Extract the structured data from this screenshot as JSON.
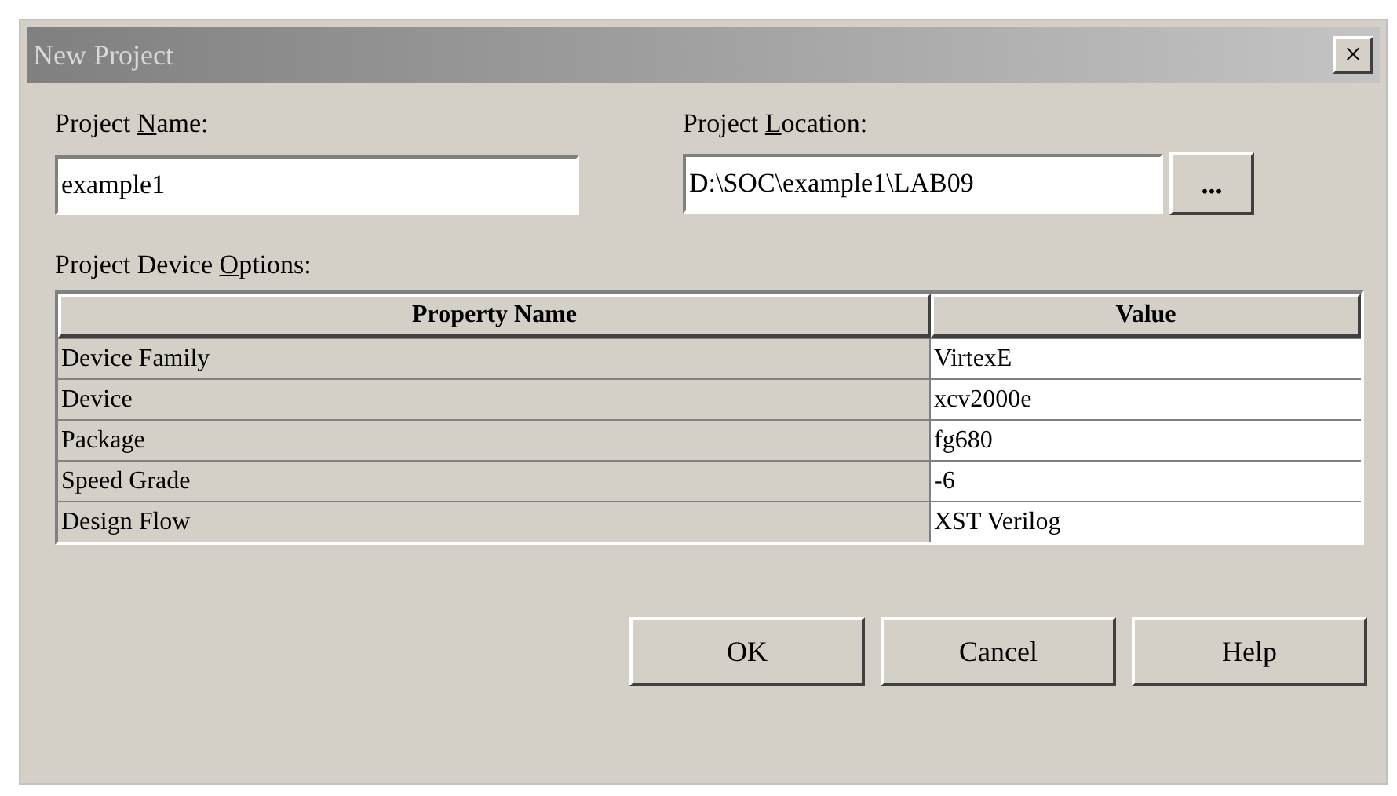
{
  "window": {
    "title": "New Project",
    "close": "×"
  },
  "project_name": {
    "label_parts": [
      "Project ",
      "N",
      "ame:"
    ],
    "value": "example1"
  },
  "project_location": {
    "label_parts": [
      "Project ",
      "L",
      "ocation:"
    ],
    "value": "D:\\SOC\\example1\\LAB09",
    "browse": "..."
  },
  "options_label_parts": [
    "Project Device ",
    "O",
    "ptions:"
  ],
  "table": {
    "columns": [
      "Property Name",
      "Value"
    ],
    "rows": [
      {
        "name": "Device Family",
        "value": "VirtexE"
      },
      {
        "name": "Device",
        "value": "xcv2000e"
      },
      {
        "name": "Package",
        "value": "fg680"
      },
      {
        "name": "Speed Grade",
        "value": "-6"
      },
      {
        "name": "Design Flow",
        "value": "XST Verilog"
      }
    ]
  },
  "buttons": [
    "OK",
    "Cancel",
    "Help"
  ]
}
